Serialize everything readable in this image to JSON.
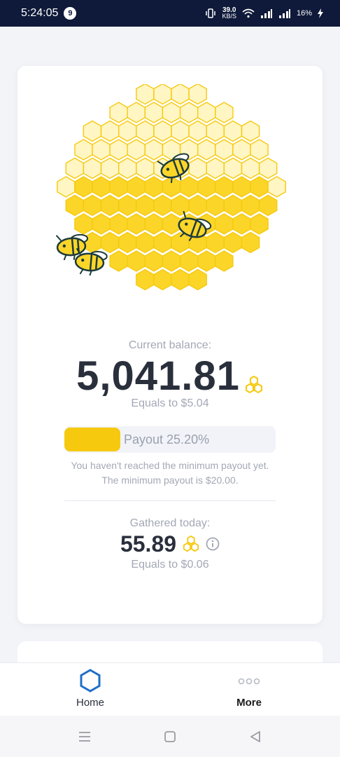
{
  "status_bar": {
    "time": "5:24:05",
    "notification_count": "9",
    "speed_value": "39.0",
    "speed_unit": "KB/S",
    "battery": "16%"
  },
  "balance": {
    "label": "Current balance:",
    "value": "5,041.81",
    "equals": "Equals to $5.04"
  },
  "payout": {
    "label": "Payout 25.20%",
    "progress_percent": 25.2,
    "note_line1": "You haven't reached the minimum payout yet.",
    "note_line2": "The minimum payout is $20.00."
  },
  "gathered": {
    "label": "Gathered today:",
    "value": "55.89",
    "equals": "Equals to $0.06"
  },
  "nav": {
    "home_label": "Home",
    "more_label": "More"
  },
  "colors": {
    "accent": "#f6c90e",
    "home_icon": "#1e6fc8",
    "text_dark": "#2a2f3c",
    "text_muted": "#a3a8b5"
  },
  "icons": {
    "coin": "honeycomb-coin-icon",
    "info": "info-icon",
    "home": "hexagon-home-icon",
    "more": "three-dots-icon"
  }
}
